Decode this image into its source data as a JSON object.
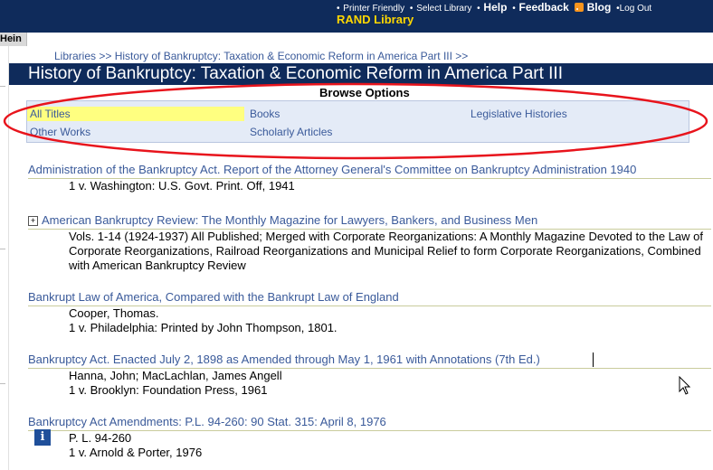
{
  "top_links": {
    "printer_friendly": "Printer Friendly",
    "select_library": "Select Library",
    "help": "Help",
    "feedback": "Feedback",
    "blog": "Blog",
    "log_out": "Log Out",
    "bullet": "•"
  },
  "library_name": "RAND Library",
  "side_tab": "Hein",
  "breadcrumb": "Libraries >> History of Bankruptcy: Taxation & Economic Reform in America Part III >>",
  "page_title": "History of Bankruptcy: Taxation & Economic Reform in America Part III",
  "browse": {
    "heading": "Browse Options",
    "options": [
      "All Titles",
      "Books",
      "Legislative Histories",
      "Other Works",
      "Scholarly Articles"
    ],
    "selected": "All Titles"
  },
  "entries": [
    {
      "title": "Administration of the Bankruptcy Act. Report of the Attorney General's Committee on Bankruptcy Administration 1940",
      "lines": [
        "1 v. Washington: U.S. Govt. Print. Off, 1941"
      ]
    },
    {
      "expand": "+",
      "title": "American Bankruptcy Review: The Monthly Magazine for Lawyers, Bankers, and Business Men",
      "lines": [
        "Vols. 1-14 (1924-1937) All Published; Merged with Corporate Reorganizations: A Monthly Magazine Devoted to the Law of Corporate Reorganizations, Railroad Reorganizations and Municipal Relief to form Corporate Reorganizations, Combined with American Bankruptcy Review"
      ]
    },
    {
      "title": "Bankrupt Law of America, Compared with the Bankrupt Law of England",
      "lines": [
        "Cooper, Thomas.",
        "1 v. Philadelphia: Printed by John Thompson, 1801."
      ]
    },
    {
      "title": "Bankruptcy Act. Enacted July 2, 1898 as Amended through May 1, 1961 with Annotations (7th Ed.)",
      "lines": [
        "Hanna, John; MacLachlan, James Angell",
        "1 v. Brooklyn: Foundation Press, 1961"
      ]
    },
    {
      "title": "Bankruptcy Act Amendments: P.L. 94-260: 90 Stat. 315: April 8, 1976",
      "info": "i",
      "lines": [
        "P. L. 94-260",
        "1 v. Arnold & Porter, 1976"
      ]
    }
  ],
  "colors": {
    "navy": "#0f2b5b",
    "link": "#3a5a9a",
    "library_name": "#ffd700",
    "selected_option": "#ffff80",
    "annotation_ellipse": "#e8141c"
  },
  "icons": [
    "rss-icon",
    "expand-plus-icon",
    "info-icon",
    "mouse-pointer-icon"
  ]
}
